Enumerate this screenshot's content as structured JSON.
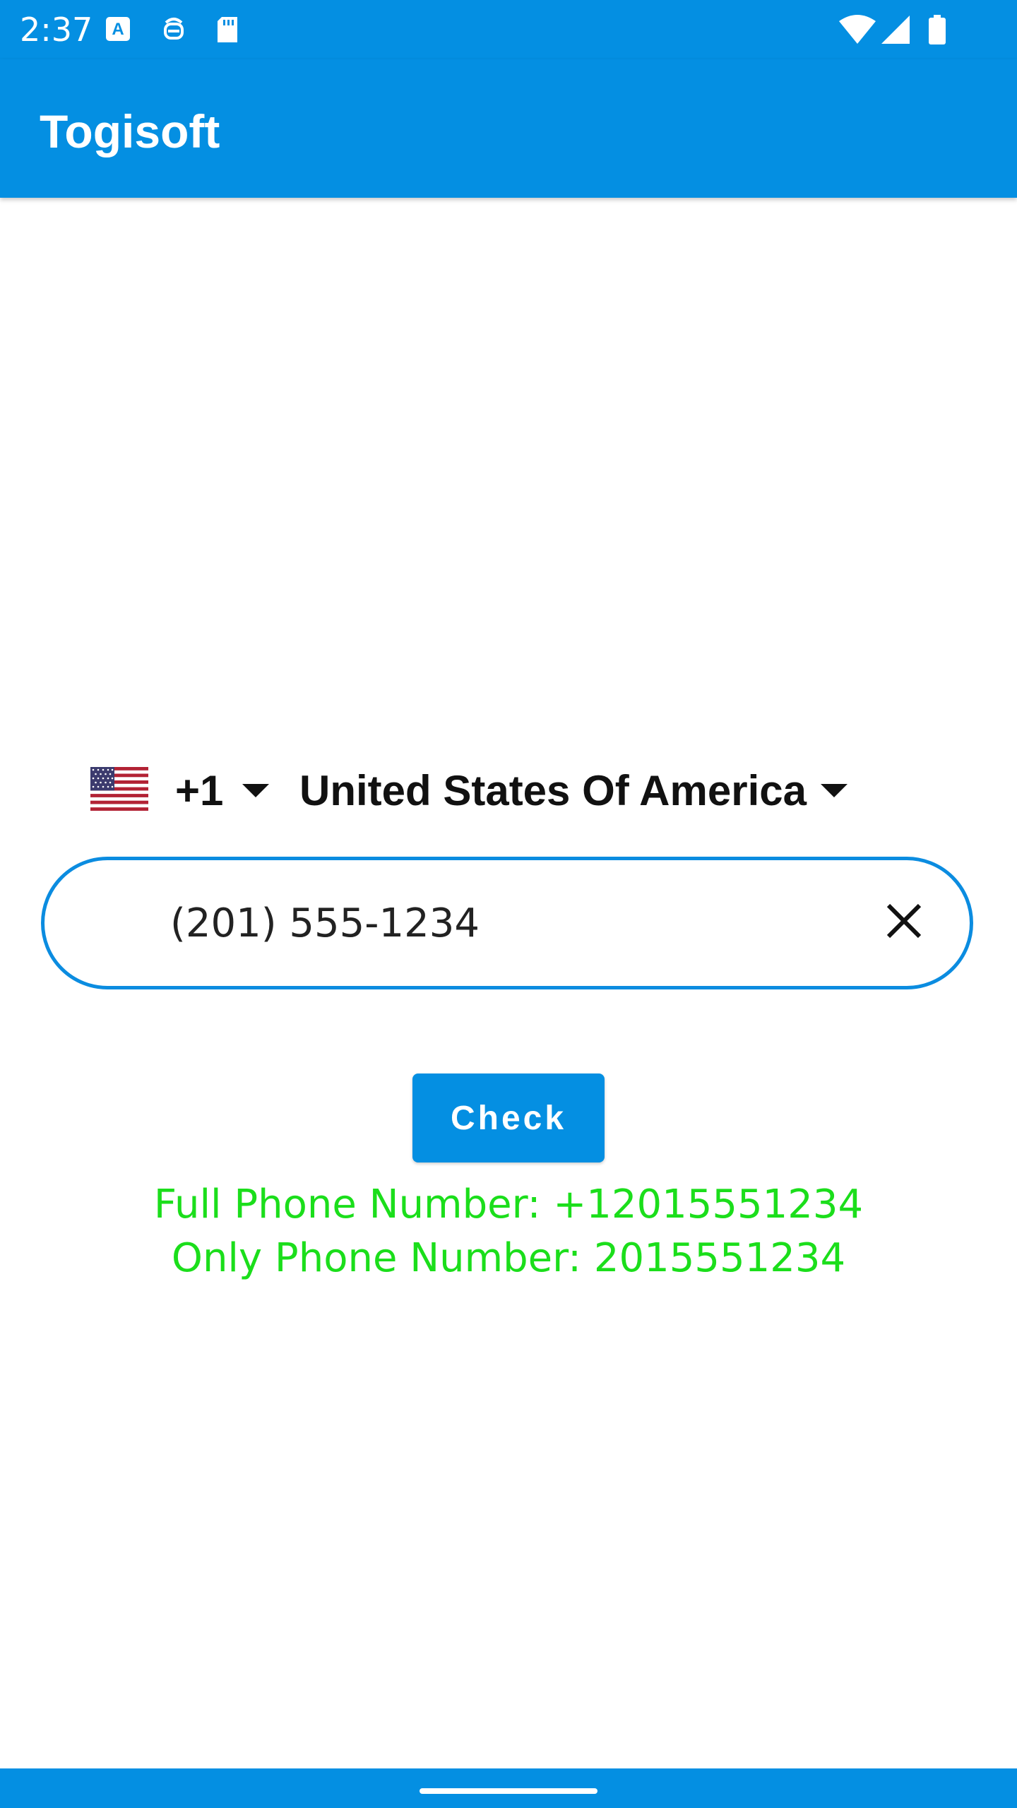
{
  "status_bar": {
    "time": "2:37",
    "left_icons": [
      "text-a-icon",
      "face-icon",
      "sd-card-icon"
    ],
    "right_icons": [
      "wifi-icon",
      "signal-icon",
      "battery-icon"
    ]
  },
  "app_bar": {
    "title": "Togisoft"
  },
  "country_picker": {
    "flag": "us-flag-icon",
    "dial_code": "+1",
    "country_name": "United States Of America"
  },
  "phone_input": {
    "value": "(201) 555-1234"
  },
  "check_button": {
    "label": "Check"
  },
  "results": {
    "full_phone": "Full Phone Number: +12015551234",
    "only_phone": "Only Phone Number: 2015551234"
  },
  "colors": {
    "primary": "#048fe2",
    "result_text": "#1bde1b",
    "field_border": "#0b8ce0"
  }
}
